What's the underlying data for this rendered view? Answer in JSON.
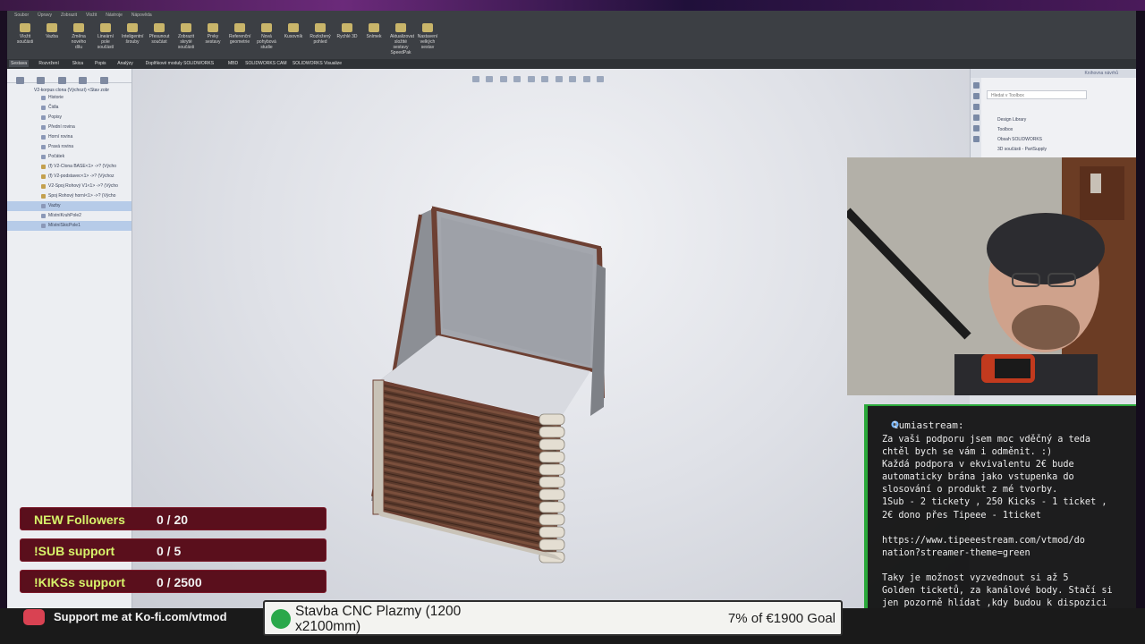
{
  "app": {
    "title_menu": [
      "Soubor",
      "Úpravy",
      "Zobrazit",
      "Vložit",
      "Nástroje",
      "Nápověda"
    ],
    "ribbon_buttons": [
      "Vložit součásti",
      "Vazba",
      "Změna nového dílu",
      "Lineární pole součástí",
      "Inteligentní šrouby",
      "Přesunout součást",
      "Zobrazit skryté součásti",
      "Prvky sestavy",
      "Referenční geometrie",
      "Nová pohybová studie",
      "Kusovník",
      "Rozložený pohled",
      "Rychlé 3D",
      "Snímek",
      "Aktualizovat složité sestavy SpeedPak",
      "Nastavení velkých sestav"
    ],
    "command_tabs": [
      "Sestava",
      "Rozvržení",
      "Skica",
      "Popis",
      "Analýzy",
      "Doplňkové moduly SOLIDWORKS",
      "MBD",
      "SOLIDWORKS CAM",
      "SOLIDWORKS Visualize"
    ]
  },
  "feature_tree": {
    "root": "V2-korpus clona (Výchozí) <Stav zobr",
    "items": [
      {
        "label": "Historie",
        "type": "folder",
        "selected": false
      },
      {
        "label": "Čidla",
        "type": "folder",
        "selected": false
      },
      {
        "label": "Popisy",
        "type": "folder",
        "selected": false
      },
      {
        "label": "Přední rovina",
        "type": "plane",
        "selected": false
      },
      {
        "label": "Horní rovina",
        "type": "plane",
        "selected": false
      },
      {
        "label": "Pravá rovina",
        "type": "plane",
        "selected": false
      },
      {
        "label": "Počátek",
        "type": "origin",
        "selected": false
      },
      {
        "label": "(f) V2-Clona BASE<1> ->? (Výcho",
        "type": "part",
        "selected": false
      },
      {
        "label": "(f) V2-podstavec<1> ->? (Výchoz",
        "type": "part",
        "selected": false
      },
      {
        "label": "V2-Spoj Rohový V1<1> ->? (Výcho",
        "type": "part",
        "selected": false
      },
      {
        "label": "Spoj Rohový horní<1> ->? (Výcho",
        "type": "part",
        "selected": false
      },
      {
        "label": "Vazby",
        "type": "mates",
        "selected": true
      },
      {
        "label": "MístníKruhPole2",
        "type": "pattern",
        "selected": false
      },
      {
        "label": "MístníSkicPole1",
        "type": "pattern",
        "selected": true
      }
    ]
  },
  "task_pane": {
    "header": "Knihovna návrhů",
    "search_placeholder": "Hledat v Toolbox",
    "items": [
      "Design Library",
      "Toolbox",
      "Obsah SOLIDWORKS",
      "3D součásti - PartSupply"
    ]
  },
  "goals": [
    {
      "name": "NEW Followers",
      "progress": "0 / 20"
    },
    {
      "name": "!SUB support",
      "progress": "0 / 5"
    },
    {
      "name": "!KIKSs support",
      "progress": "0 / 2500"
    }
  ],
  "chat": {
    "username": "lumiastream:",
    "message": "Za vaši podporu jsem moc vděčný a teda\nchtěl bych se vám i odměnit. :)\nKaždá podpora v ekvivalentu 2€ bude\nautomaticky brána jako vstupenka do\nslosování o produkt z mé tvorby.\n1Sub - 2 tickety , 250 Kicks - 1 ticket ,\n2€ dono přes Tipeee - 1ticket\n\nhttps://www.tipeeestream.com/vtmod/do\nnation?streamer-theme=green\n\nTaky je možnost vyzvednout si až 5\nGolden ticketů, za kanálové body. Stačí si\njen pozorně hlídat ,kdy budou k dispozici\nběhem streamu .. :)"
  },
  "kofi": {
    "text": "Support me at Ko-fi.com/vtmod"
  },
  "tipeee": {
    "title": "Stavba CNC Plazmy (1200 x2100mm)",
    "goal_text": "7% of €1900 Goal",
    "percent": 7
  },
  "colors": {
    "goal_bg": "#5a0f1c",
    "goal_text": "#d7f36a",
    "chat_border": "#2aa83a",
    "kofi": "#d94252"
  }
}
